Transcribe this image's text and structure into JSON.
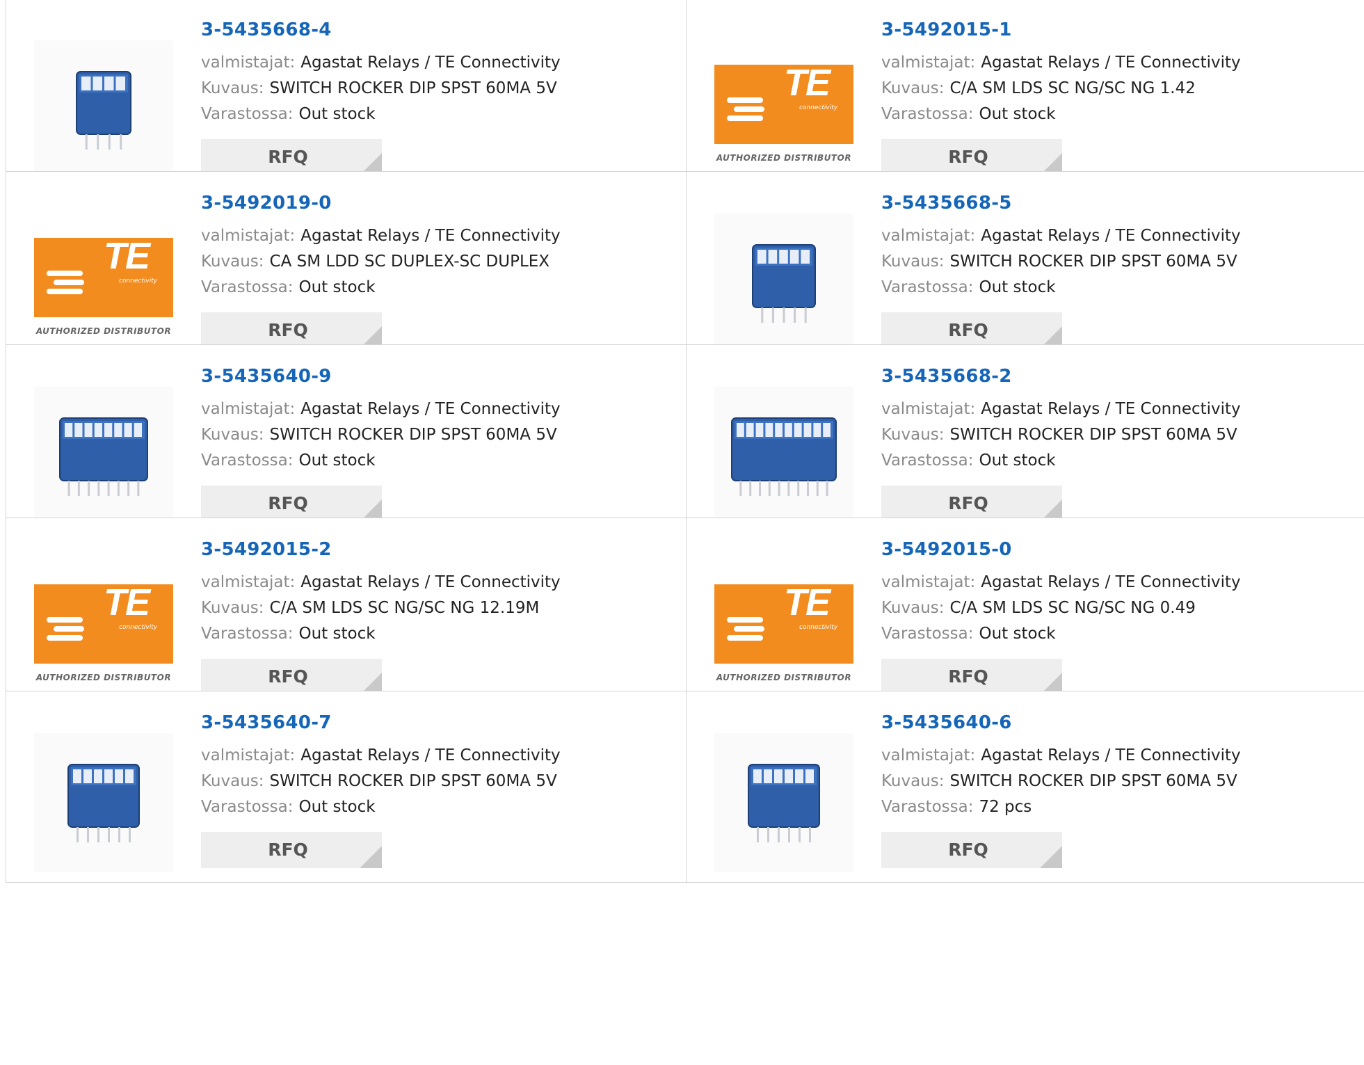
{
  "labels": {
    "manufacturer": "valmistajat:",
    "description": "Kuvaus:",
    "stock": "Varastossa:",
    "rfq": "RFQ",
    "te_brand": "TE",
    "te_sub": "connectivity",
    "te_authorized": "AUTHORIZED DISTRIBUTOR"
  },
  "products": [
    {
      "part": "3-5435668-4",
      "manufacturer": "Agastat Relays / TE Connectivity",
      "description": "SWITCH ROCKER DIP SPST 60MA 5V",
      "stock": "Out stock",
      "image": "dip-switch-4"
    },
    {
      "part": "3-5492015-1",
      "manufacturer": "Agastat Relays / TE Connectivity",
      "description": "C/A SM LDS SC NG/SC NG 1.42",
      "stock": "Out stock",
      "image": "te-logo"
    },
    {
      "part": "3-5492019-0",
      "manufacturer": "Agastat Relays / TE Connectivity",
      "description": "CA SM LDD SC DUPLEX-SC DUPLEX",
      "stock": "Out stock",
      "image": "te-logo"
    },
    {
      "part": "3-5435668-5",
      "manufacturer": "Agastat Relays / TE Connectivity",
      "description": "SWITCH ROCKER DIP SPST 60MA 5V",
      "stock": "Out stock",
      "image": "dip-switch-5"
    },
    {
      "part": "3-5435640-9",
      "manufacturer": "Agastat Relays / TE Connectivity",
      "description": "SWITCH ROCKER DIP SPST 60MA 5V",
      "stock": "Out stock",
      "image": "dip-switch-8"
    },
    {
      "part": "3-5435668-2",
      "manufacturer": "Agastat Relays / TE Connectivity",
      "description": "SWITCH ROCKER DIP SPST 60MA 5V",
      "stock": "Out stock",
      "image": "dip-switch-10"
    },
    {
      "part": "3-5492015-2",
      "manufacturer": "Agastat Relays / TE Connectivity",
      "description": "C/A SM LDS SC NG/SC NG 12.19M",
      "stock": "Out stock",
      "image": "te-logo"
    },
    {
      "part": "3-5492015-0",
      "manufacturer": "Agastat Relays / TE Connectivity",
      "description": "C/A SM LDS SC NG/SC NG 0.49",
      "stock": "Out stock",
      "image": "te-logo"
    },
    {
      "part": "3-5435640-7",
      "manufacturer": "Agastat Relays / TE Connectivity",
      "description": "SWITCH ROCKER DIP SPST 60MA 5V",
      "stock": "Out stock",
      "image": "dip-switch-6"
    },
    {
      "part": "3-5435640-6",
      "manufacturer": "Agastat Relays / TE Connectivity",
      "description": "SWITCH ROCKER DIP SPST 60MA 5V",
      "stock": "72 pcs",
      "image": "dip-switch-6"
    }
  ]
}
